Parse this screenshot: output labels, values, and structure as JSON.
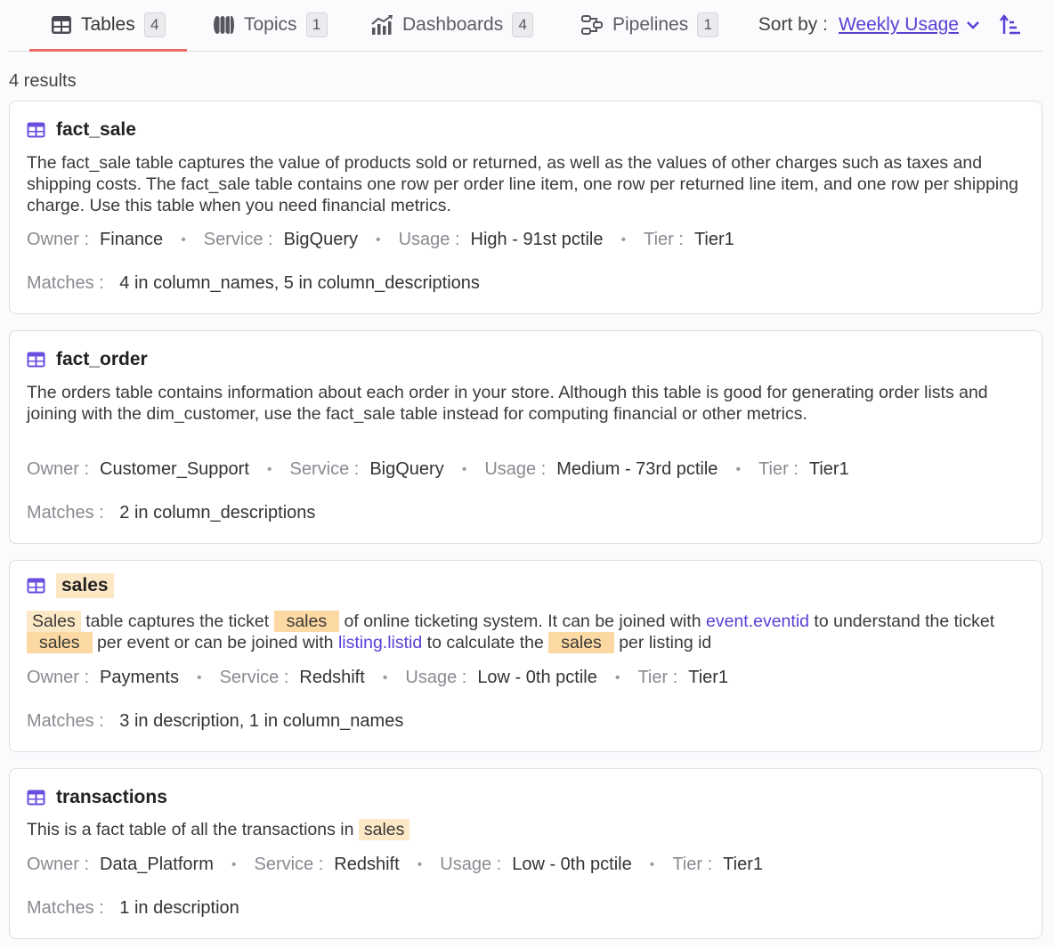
{
  "tabs": [
    {
      "label": "Tables",
      "count": "4",
      "active": true,
      "icon": "table-icon"
    },
    {
      "label": "Topics",
      "count": "1",
      "icon": "topics-icon"
    },
    {
      "label": "Dashboards",
      "count": "4",
      "icon": "dashboard-icon"
    },
    {
      "label": "Pipelines",
      "count": "1",
      "icon": "pipeline-icon"
    }
  ],
  "sort": {
    "label": "Sort by :",
    "value": "Weekly Usage",
    "order_icon": "sort-ascending-icon"
  },
  "results_count": "4 results",
  "colors": {
    "accent": "#5b3fd6",
    "active_tab_underline": "#ef6c61",
    "highlight": "#fde8c6"
  },
  "meta_labels": {
    "owner": "Owner :",
    "service": "Service :",
    "usage": "Usage :",
    "tier": "Tier :",
    "matches": "Matches :"
  },
  "cards": [
    {
      "name": "fact_sale",
      "description": "The fact_sale table captures the value of products sold or returned, as well as the values of other charges such as taxes and shipping costs. The fact_sale table contains one row per order line item, one row per returned line item, and one row per shipping charge. Use this table when you need financial metrics.",
      "owner": "Finance",
      "service": "BigQuery",
      "usage": "High - 91st pctile",
      "tier": "Tier1",
      "matches": "4 in column_names,  5 in column_descriptions"
    },
    {
      "name": "fact_order",
      "description": "The orders table contains information about each order in your store. Although this table is good for generating order lists and joining with the dim_customer, use the fact_sale table instead for computing financial or other metrics.",
      "owner": "Customer_Support",
      "service": "BigQuery",
      "usage": "Medium - 73rd pctile",
      "tier": "Tier1",
      "matches": "2 in column_descriptions"
    },
    {
      "name": "sales",
      "description_parts": {
        "w1": "Sales",
        "t1": " table captures the ticket ",
        "w2": "sales",
        "t2": " of online ticketing system. It can be joined with ",
        "link1": "event.eventid",
        "t3": " to understand the ticket ",
        "w3": "sales",
        "t4": " per event or can be joined with ",
        "link2": "listing.listid",
        "t5": " to calculate the ",
        "w4": "sales",
        "t6": " per listing id"
      },
      "owner": "Payments",
      "service": "Redshift",
      "usage": "Low - 0th pctile",
      "tier": "Tier1",
      "matches": "3 in description,  1 in column_names"
    },
    {
      "name": "transactions",
      "description_parts": {
        "t1": "This is a fact table of all the transactions in ",
        "w1": "sales"
      },
      "owner": "Data_Platform",
      "service": "Redshift",
      "usage": "Low - 0th pctile",
      "tier": "Tier1",
      "matches": "1 in description"
    }
  ]
}
